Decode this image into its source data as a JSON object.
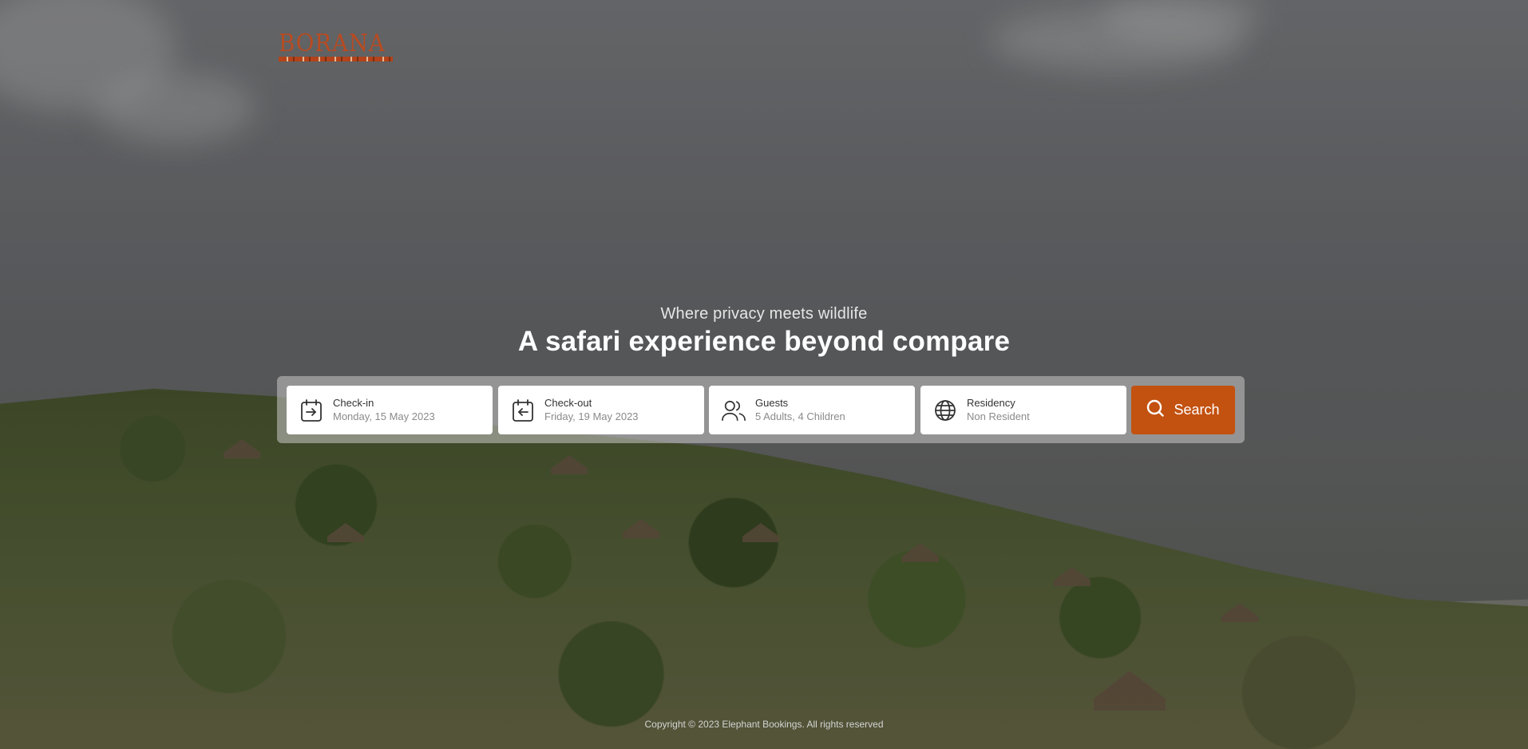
{
  "brand": {
    "logo_text": "BORANA",
    "accent_color": "#c3510f"
  },
  "hero": {
    "tagline": "Where privacy meets wildlife",
    "headline": "A safari experience beyond compare"
  },
  "search": {
    "fields": [
      {
        "label": "Check-in",
        "value": "Monday, 15 May 2023",
        "icon": "calendar-arrow-in-icon"
      },
      {
        "label": "Check-out",
        "value": "Friday, 19 May 2023",
        "icon": "calendar-arrow-out-icon"
      },
      {
        "label": "Guests",
        "value": "5 Adults, 4 Children",
        "icon": "users-icon"
      },
      {
        "label": "Residency",
        "value": "Non Resident",
        "icon": "globe-icon"
      }
    ],
    "button_label": "Search",
    "button_icon": "search-icon"
  },
  "footer": {
    "copyright": "Copyright © 2023 Elephant Bookings. All rights reserved"
  }
}
